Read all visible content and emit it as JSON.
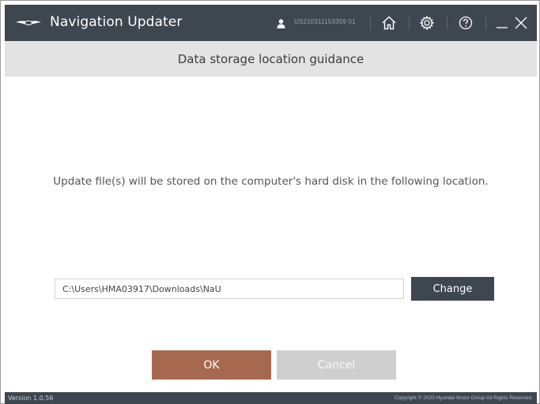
{
  "app": {
    "title": "Navigation Updater",
    "user_id": "US210311153359 01"
  },
  "header": {
    "title": "Data storage location guidance"
  },
  "content": {
    "message": "Update file(s) will be stored on the computer's hard disk in the following location.",
    "path_value": "C:\\Users\\HMA03917\\Downloads\\NaU",
    "change_label": "Change"
  },
  "actions": {
    "ok_label": "OK",
    "cancel_label": "Cancel"
  },
  "footer": {
    "version": "Version 1.0.56",
    "copyright": "Copyright © 2020 Hyundai Motor Group All Rights Reserved."
  },
  "icons": {
    "logo": "winged-logo-icon",
    "user": "user-icon",
    "home": "home-icon",
    "settings": "gear-icon",
    "help": "help-icon",
    "minimize": "minimize-icon",
    "close": "close-icon"
  },
  "colors": {
    "titlebar": "#3e4650",
    "header": "#e3e3e3",
    "ok_button": "#a76850",
    "cancel_button": "#cfcfcf",
    "change_button": "#3e4650"
  }
}
